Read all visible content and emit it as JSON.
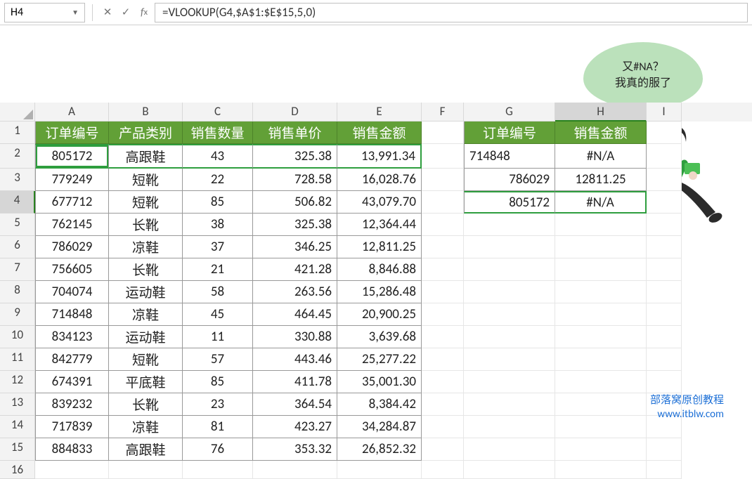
{
  "name_box": "H4",
  "formula": "=VLOOKUP(G4,$A$1:$E$15,5,0)",
  "columns": [
    "A",
    "B",
    "C",
    "D",
    "E",
    "F",
    "G",
    "H",
    "I"
  ],
  "row_labels": [
    "1",
    "2",
    "3",
    "4",
    "5",
    "6",
    "7",
    "8",
    "9",
    "10",
    "11",
    "12",
    "13",
    "14",
    "15",
    "16"
  ],
  "main_headers": {
    "A": "订单编号",
    "B": "产品类别",
    "C": "销售数量",
    "D": "销售单价",
    "E": "销售金额"
  },
  "lookup_headers": {
    "G": "订单编号",
    "H": "销售金额"
  },
  "main_data": [
    {
      "A": "805172",
      "B": "高跟鞋",
      "C": "43",
      "D": "325.38",
      "E": "13,991.34"
    },
    {
      "A": "779249",
      "B": "短靴",
      "C": "22",
      "D": "728.58",
      "E": "16,028.76"
    },
    {
      "A": "677712",
      "B": "短靴",
      "C": "85",
      "D": "506.82",
      "E": "43,079.70"
    },
    {
      "A": "762145",
      "B": "长靴",
      "C": "38",
      "D": "325.38",
      "E": "12,364.44"
    },
    {
      "A": "786029",
      "B": "凉鞋",
      "C": "37",
      "D": "346.25",
      "E": "12,811.25"
    },
    {
      "A": "756605",
      "B": "长靴",
      "C": "21",
      "D": "421.28",
      "E": "8,846.88"
    },
    {
      "A": "704074",
      "B": "运动鞋",
      "C": "58",
      "D": "263.56",
      "E": "15,286.48"
    },
    {
      "A": "714848",
      "B": "凉鞋",
      "C": "45",
      "D": "464.45",
      "E": "20,900.25"
    },
    {
      "A": "834123",
      "B": "运动鞋",
      "C": "11",
      "D": "330.88",
      "E": "3,639.68"
    },
    {
      "A": "842779",
      "B": "短靴",
      "C": "57",
      "D": "443.46",
      "E": "25,277.22"
    },
    {
      "A": "674391",
      "B": "平底鞋",
      "C": "85",
      "D": "411.78",
      "E": "35,001.30"
    },
    {
      "A": "839232",
      "B": "长靴",
      "C": "23",
      "D": "364.54",
      "E": "8,384.42"
    },
    {
      "A": "717839",
      "B": "凉鞋",
      "C": "81",
      "D": "423.27",
      "E": "34,284.87"
    },
    {
      "A": "884833",
      "B": "高跟鞋",
      "C": "76",
      "D": "353.32",
      "E": "26,852.32"
    }
  ],
  "lookup_data": [
    {
      "G": "714848",
      "H": "#N/A"
    },
    {
      "G": "786029",
      "H": "12811.25"
    },
    {
      "G": "805172",
      "H": "#N/A"
    }
  ],
  "bubble": {
    "line1": "又#NA？",
    "line2": "我真的服了"
  },
  "credit": {
    "line1": "部落窝原创教程",
    "line2": "www.itblw.com"
  }
}
